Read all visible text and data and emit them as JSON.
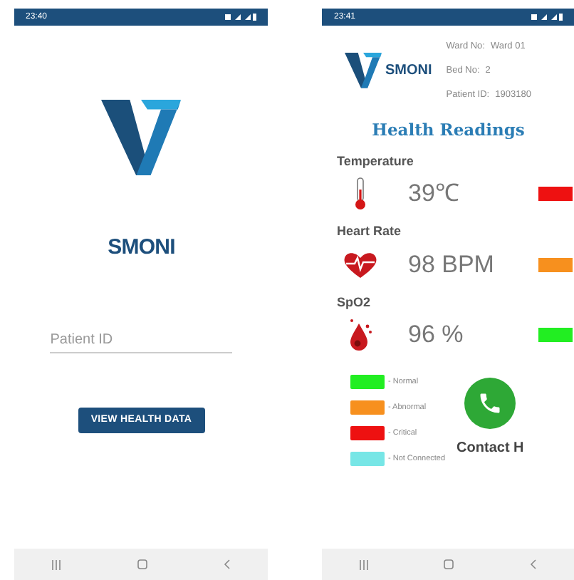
{
  "login_screen": {
    "status_bar": {
      "time": "23:40"
    },
    "app_name": "SMONI",
    "patient_id_field": {
      "placeholder": "Patient ID"
    },
    "button": "VIEW HEALTH DATA"
  },
  "readings_screen": {
    "status_bar": {
      "time": "23:41"
    },
    "app_name": "SMONI",
    "info": [
      {
        "label": "Ward No:",
        "value": "Ward 01"
      },
      {
        "label": "Bed No:",
        "value": "2"
      },
      {
        "label": "Patient ID:",
        "value": "1903180"
      }
    ],
    "title": "Health Readings",
    "readings": [
      {
        "kind": "temperature",
        "label": "Temperature",
        "value": "39℃",
        "color": "#ee1111"
      },
      {
        "kind": "heart",
        "label": "Heart Rate",
        "value": "98 BPM",
        "color": "#f7901e"
      },
      {
        "kind": "spo2",
        "label": "SpO2",
        "value": "96 %",
        "color": "#22ee22"
      }
    ],
    "legend": [
      {
        "label": "- Normal",
        "color": "#22ee22"
      },
      {
        "label": "- Abnormal",
        "color": "#f7901e"
      },
      {
        "label": "- Critical",
        "color": "#ee1111"
      },
      {
        "label": "- Not Connected",
        "color": "#77e6e6"
      }
    ],
    "contact_label": "Contact H"
  }
}
